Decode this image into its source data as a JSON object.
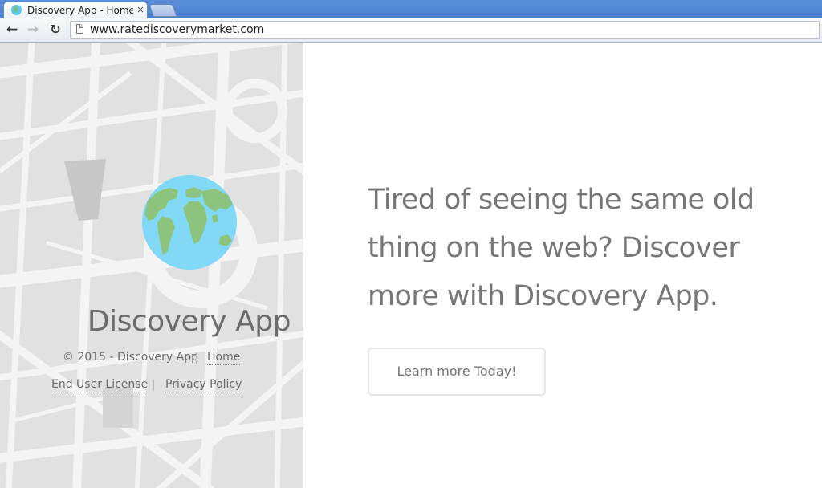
{
  "browser": {
    "tab_title": "Discovery App - Home Page",
    "tab_close": "×",
    "url": "www.ratediscoverymarket.com",
    "icons": {
      "back": "arrow-left",
      "forward": "arrow-right",
      "reload": "reload",
      "page": "page-icon"
    }
  },
  "sidebar": {
    "brand": "Discovery App",
    "copyright": "© 2015 - Discovery App",
    "links": {
      "home": "Home",
      "eula": "End User License",
      "privacy": "Privacy Policy"
    }
  },
  "main": {
    "headline": "Tired of seeing the same old thing on the web? Discover more with Discovery App.",
    "cta_label": "Learn more Today!"
  },
  "colors": {
    "globe_ocean": "#82d8f7",
    "globe_land": "#8dc47d",
    "map_background": "#e2e2e2",
    "map_roads": "#f5f5f5",
    "text_gray": "#777777"
  }
}
